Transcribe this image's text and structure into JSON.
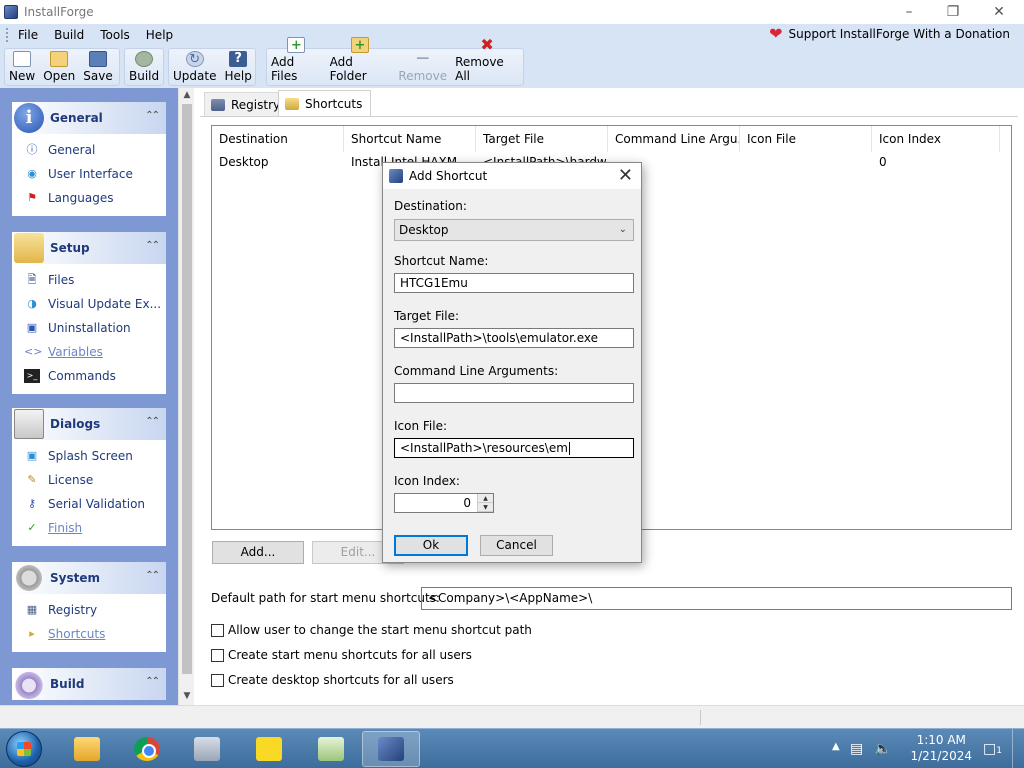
{
  "window": {
    "title": "InstallForge"
  },
  "menu": [
    "File",
    "Build",
    "Tools",
    "Help"
  ],
  "donation": "Support InstallForge With a Donation",
  "toolbar": {
    "new": "New",
    "open": "Open",
    "save": "Save",
    "build": "Build",
    "update": "Update",
    "help": "Help",
    "add_files": "Add Files",
    "add_folder": "Add Folder",
    "remove": "Remove",
    "remove_all": "Remove All"
  },
  "sidebar": {
    "general": {
      "title": "General",
      "items": [
        "General",
        "User Interface",
        "Languages"
      ]
    },
    "setup": {
      "title": "Setup",
      "items": [
        "Files",
        "Visual Update Ex...",
        "Uninstallation",
        "Variables",
        "Commands"
      ]
    },
    "dialogs": {
      "title": "Dialogs",
      "items": [
        "Splash Screen",
        "License",
        "Serial Validation",
        "Finish"
      ]
    },
    "system": {
      "title": "System",
      "items": [
        "Registry",
        "Shortcuts"
      ]
    },
    "build": {
      "title": "Build"
    }
  },
  "tabs": {
    "registry": "Registry",
    "shortcuts": "Shortcuts"
  },
  "list": {
    "columns": [
      "Destination",
      "Shortcut Name",
      "Target File",
      "Command Line Argu...",
      "Icon File",
      "Icon Index"
    ],
    "rows": [
      [
        "Desktop",
        "Install Intel HAXM",
        "<InstallPath>\\hardw...",
        "",
        "",
        "0"
      ]
    ]
  },
  "buttons": {
    "add": "Add...",
    "edit": "Edit..."
  },
  "start_menu": {
    "label": "Default path for start menu shortcuts:",
    "value": "<Company>\\<AppName>\\",
    "checks": [
      "Allow user to change the start menu shortcut path",
      "Create start menu shortcuts for all users",
      "Create desktop shortcuts for all users"
    ]
  },
  "dialog": {
    "title": "Add Shortcut",
    "destination_label": "Destination:",
    "destination_value": "Desktop",
    "shortcut_name_label": "Shortcut Name:",
    "shortcut_name_value": "HTCG1Emu",
    "target_file_label": "Target File:",
    "target_file_value": "<InstallPath>\\tools\\emulator.exe",
    "cmd_args_label": "Command Line Arguments:",
    "cmd_args_value": "",
    "icon_file_label": "Icon File:",
    "icon_file_value": "<InstallPath>\\resources\\em",
    "icon_index_label": "Icon Index:",
    "icon_index_value": "0",
    "ok": "Ok",
    "cancel": "Cancel"
  },
  "clock": {
    "time": "1:10 AM",
    "date": "1/21/2024"
  },
  "notifications": "1"
}
